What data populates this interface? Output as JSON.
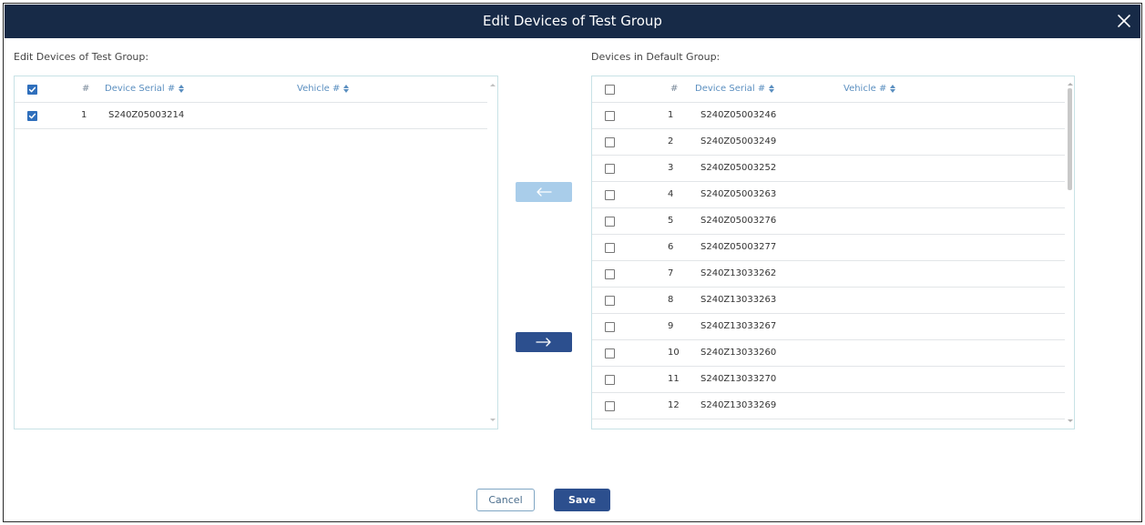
{
  "dialog": {
    "title": "Edit Devices of Test Group"
  },
  "left_panel": {
    "label": "Edit Devices of Test Group:",
    "columns": {
      "num": "#",
      "serial": "Device Serial #",
      "vehicle": "Vehicle #"
    },
    "select_all_checked": true,
    "rows": [
      {
        "num": "1",
        "serial": "S240Z05003214",
        "vehicle": "",
        "checked": true
      }
    ]
  },
  "right_panel": {
    "label": "Devices in Default Group:",
    "columns": {
      "num": "#",
      "serial": "Device Serial #",
      "vehicle": "Vehicle #"
    },
    "select_all_checked": false,
    "rows": [
      {
        "num": "1",
        "serial": "S240Z05003246",
        "vehicle": "",
        "checked": false
      },
      {
        "num": "2",
        "serial": "S240Z05003249",
        "vehicle": "",
        "checked": false
      },
      {
        "num": "3",
        "serial": "S240Z05003252",
        "vehicle": "",
        "checked": false
      },
      {
        "num": "4",
        "serial": "S240Z05003263",
        "vehicle": "",
        "checked": false
      },
      {
        "num": "5",
        "serial": "S240Z05003276",
        "vehicle": "",
        "checked": false
      },
      {
        "num": "6",
        "serial": "S240Z05003277",
        "vehicle": "",
        "checked": false
      },
      {
        "num": "7",
        "serial": "S240Z13033262",
        "vehicle": "",
        "checked": false
      },
      {
        "num": "8",
        "serial": "S240Z13033263",
        "vehicle": "",
        "checked": false
      },
      {
        "num": "9",
        "serial": "S240Z13033267",
        "vehicle": "",
        "checked": false
      },
      {
        "num": "10",
        "serial": "S240Z13033260",
        "vehicle": "",
        "checked": false
      },
      {
        "num": "11",
        "serial": "S240Z13033270",
        "vehicle": "",
        "checked": false
      },
      {
        "num": "12",
        "serial": "S240Z13033269",
        "vehicle": "",
        "checked": false
      }
    ]
  },
  "transfer": {
    "move_left": {
      "icon": "arrow-left-icon",
      "enabled": false
    },
    "move_right": {
      "icon": "arrow-right-icon",
      "enabled": true
    }
  },
  "footer": {
    "cancel_label": "Cancel",
    "save_label": "Save"
  },
  "colors": {
    "titlebar": "#172a47",
    "primary_button": "#2c4f8e",
    "disabled_button": "#a9cdea",
    "checkbox_checked": "#2f6fbc",
    "header_text": "#5b8fc0",
    "panel_border": "#c8e2e6"
  }
}
